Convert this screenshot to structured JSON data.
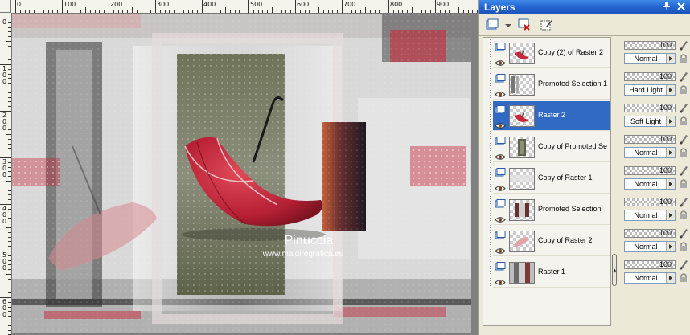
{
  "ruler": {
    "top_labels": [
      "0",
      "100",
      "200",
      "300",
      "400",
      "500",
      "600",
      "700",
      "800",
      "900"
    ],
    "left_labels": [
      "0",
      "100",
      "200",
      "300",
      "400",
      "500",
      "600"
    ]
  },
  "watermark": {
    "line1": "Pinuccia",
    "line2": "www.maidiregrafica.eu"
  },
  "layers_panel": {
    "title": "Layers",
    "layers": [
      {
        "name": "Copy (2) of Raster 2",
        "opacity": "100",
        "blend": "Normal",
        "selected": false,
        "thumb": "red-umbrella"
      },
      {
        "name": "Promoted Selection 1",
        "opacity": "100",
        "blend": "Hard Light",
        "selected": false,
        "thumb": "gray-strip"
      },
      {
        "name": "Raster 2",
        "opacity": "100",
        "blend": "Soft Light",
        "selected": true,
        "thumb": "red-umbrella"
      },
      {
        "name": "Copy of Promoted Se",
        "opacity": "100",
        "blend": "Normal",
        "selected": false,
        "thumb": "dark-panel"
      },
      {
        "name": "Copy of Raster 1",
        "opacity": "100",
        "blend": "Normal",
        "selected": false,
        "thumb": "light-strip"
      },
      {
        "name": "Promoted Selection",
        "opacity": "100",
        "blend": "Normal",
        "selected": false,
        "thumb": "dark-frame"
      },
      {
        "name": "Copy of Raster 2",
        "opacity": "100",
        "blend": "Normal",
        "selected": false,
        "thumb": "pale-umbrella"
      },
      {
        "name": "Raster 1",
        "opacity": "100",
        "blend": "Normal",
        "selected": false,
        "thumb": "full-image"
      }
    ]
  },
  "colors": {
    "title_bar": "#2464d0",
    "selection": "#316ac5",
    "panel_bg": "#ece9d8",
    "umbrella_red": "#c8283a"
  }
}
